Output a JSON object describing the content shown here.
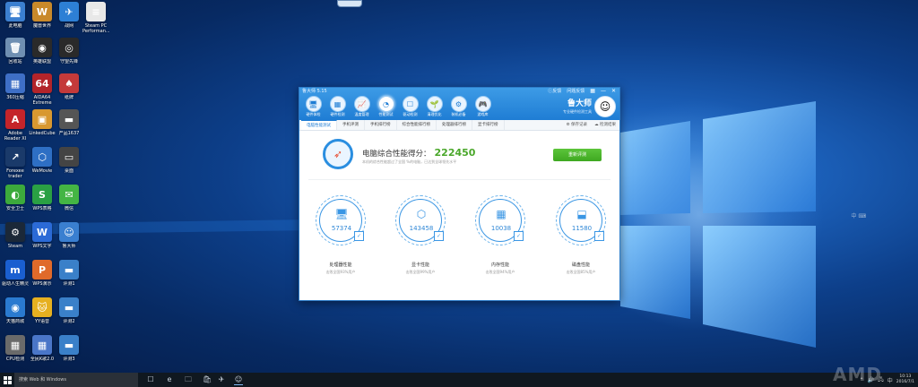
{
  "desktop": {
    "icons": [
      {
        "label": "此电脑",
        "glyph": "🖥",
        "color": "#3b7fd0"
      },
      {
        "label": "魔兽世界",
        "glyph": "W",
        "color": "#c9892a"
      },
      {
        "label": "战网",
        "glyph": "✈",
        "color": "#2d7fd5"
      },
      {
        "label": "Steam PC Performan...",
        "glyph": "≡",
        "color": "#e8e8e8"
      },
      {
        "label": "回收站",
        "glyph": "🗑",
        "color": "#6f8fb2"
      },
      {
        "label": "英雄联盟",
        "glyph": "◉",
        "color": "#2a2a2a"
      },
      {
        "label": "守望先锋",
        "glyph": "◎",
        "color": "#2a2a2a"
      },
      {
        "label": "360压缩",
        "glyph": "▦",
        "color": "#3e6fc6"
      },
      {
        "label": "AIDA64 Extreme",
        "glyph": "64",
        "color": "#b3242a"
      },
      {
        "label": "纸牌",
        "glyph": "♠",
        "color": "#c43a3a"
      },
      {
        "label": "Adobe Reader XI",
        "glyph": "A",
        "color": "#c4242a"
      },
      {
        "label": "LinkedCube",
        "glyph": "▣",
        "color": "#d89830"
      },
      {
        "label": "产品1637",
        "glyph": "▬",
        "color": "#555555"
      },
      {
        "label": "Forexee trader",
        "glyph": "↗",
        "color": "#1a3a6a"
      },
      {
        "label": "WeMovie",
        "glyph": "⬡",
        "color": "#2e6fc4"
      },
      {
        "label": "桌面",
        "glyph": "▭",
        "color": "#444444"
      },
      {
        "label": "安全卫士",
        "glyph": "◐",
        "color": "#3caa3c"
      },
      {
        "label": "WPS表格",
        "glyph": "S",
        "color": "#2aa044"
      },
      {
        "label": "微信",
        "glyph": "✉",
        "color": "#44b544"
      },
      {
        "label": "Steam",
        "glyph": "⚙",
        "color": "#1b2838"
      },
      {
        "label": "WPS文字",
        "glyph": "W",
        "color": "#2b6ad6"
      },
      {
        "label": "鲁大师",
        "glyph": "☺",
        "color": "#3a7fd0"
      },
      {
        "label": "驱动人生精灵",
        "glyph": "m",
        "color": "#1a5fd0"
      },
      {
        "label": "WPS演示",
        "glyph": "P",
        "color": "#e06a2a"
      },
      {
        "label": "评测1",
        "glyph": "▬",
        "color": "#3a80c9"
      },
      {
        "label": "天猫商城",
        "glyph": "◉",
        "color": "#2a7ad0"
      },
      {
        "label": "YY语音",
        "glyph": "🐱",
        "color": "#e6b020"
      },
      {
        "label": "评测2",
        "glyph": "▬",
        "color": "#3a80c9"
      },
      {
        "label": "CPU检测",
        "glyph": "▦",
        "color": "#6a6a6a"
      },
      {
        "label": "全民K歌2.0",
        "glyph": "▦",
        "color": "#4a76c8"
      },
      {
        "label": "评测3",
        "glyph": "▬",
        "color": "#3a80c9"
      }
    ]
  },
  "window": {
    "title": "鲁大师 5.15",
    "topright": [
      "ⓘ反馈",
      "问题反馈",
      "▦",
      "—",
      "✕"
    ],
    "toolbar": [
      {
        "label": "硬件体检",
        "glyph": "🖥"
      },
      {
        "label": "硬件检测",
        "glyph": "▦"
      },
      {
        "label": "温度管理",
        "glyph": "📈"
      },
      {
        "label": "性能测试",
        "glyph": "◔",
        "active": true
      },
      {
        "label": "驱动检测",
        "glyph": "☐"
      },
      {
        "label": "清理优化",
        "glyph": "🌱"
      },
      {
        "label": "装机必备",
        "glyph": "⚙"
      },
      {
        "label": "游戏库",
        "glyph": "🎮"
      }
    ],
    "brand": {
      "name": "鲁大师",
      "sub": "专业硬件检测工具",
      "avatar": "☺"
    },
    "subtabs": [
      "电脑性能测试",
      "手机评测",
      "手机排行榜",
      "综合性能排行榜",
      "处理器排行榜",
      "显卡排行榜"
    ],
    "subtabs_right": [
      "⚙ 保存记录",
      "☁ 检测结果"
    ],
    "score": {
      "title": "电脑综合性能得分：",
      "value": "222450",
      "desc": "本机的综合性能超过了全国    %的电脑，已达到全球领先水平",
      "button": "重新评测"
    },
    "metrics": [
      {
        "value": "57374",
        "label": "处理器性能",
        "sub": "击败全国93%用户",
        "glyph": "🖥"
      },
      {
        "value": "143458",
        "label": "显卡性能",
        "sub": "击败全国99%用户",
        "glyph": "⬡"
      },
      {
        "value": "10038",
        "label": "内存性能",
        "sub": "击败全国94%用户",
        "glyph": "▦"
      },
      {
        "value": "11580",
        "label": "磁盘性能",
        "sub": "击败全国85%用户",
        "glyph": "⬓"
      }
    ]
  },
  "taskbar": {
    "search_placeholder": "搜索 Web 和 Windows",
    "icons": [
      "☐",
      "e",
      "🗀",
      "🛍",
      "✈",
      "☺"
    ],
    "tray": [
      "⌃",
      "🔊",
      "🖧",
      "中"
    ],
    "time": "10:13",
    "date": "2016/7/1",
    "watermark": "AMD"
  }
}
